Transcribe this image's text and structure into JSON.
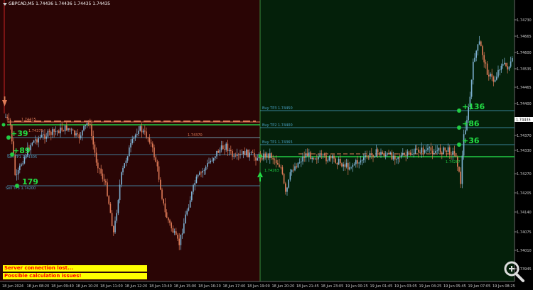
{
  "symbol_header": "GBPCAD,M5  1.74436  1.74436  1.74435  1.74435",
  "warnings": {
    "server": "Server connection lost...",
    "calc": "Possible calculation issues!"
  },
  "price_axis": [
    "1.74730",
    "1.74665",
    "1.74600",
    "1.74535",
    "1.74465",
    "1.74400",
    "1.74370",
    "1.74330",
    "1.74270",
    "1.74205",
    "1.74140",
    "1.74075",
    "1.74010",
    "1.73945"
  ],
  "current_price": "1.74435",
  "time_axis": [
    "18 Jun 2024",
    "18 Jun 08:20",
    "18 Jun 09:40",
    "18 Jun 10:20",
    "18 Jun 11:00",
    "18 Jun 12:20",
    "18 Jun 13:40",
    "18 Jun 15:00",
    "18 Jun 16:20",
    "18 Jun 17:40",
    "18 Jun 19:00",
    "18 Jun 20:20",
    "18 Jun 21:45",
    "18 Jun 23:05",
    "19 Jun 00:25",
    "19 Jun 01:45",
    "19 Jun 03:05",
    "19 Jun 04:25",
    "19 Jun 05:45",
    "19 Jun 07:05",
    "19 Jun 08:25"
  ],
  "levels": {
    "left_top": "1.74415",
    "left_mid": "1.74370",
    "left_upper_small": "1.74375",
    "tp3": "Buy TP3 1.74450",
    "tp2": "Buy TP2 1.74400",
    "tp1": "Buy TP1 1.74365",
    "sell_tp": "Sell TP3 1.74200",
    "left_entry_a": "Sell TP1 1.74305",
    "entry_right": "1.74263",
    "entry_right2": "1.74287"
  },
  "pips": {
    "p1": "+39",
    "p2": "+89",
    "p3": "179",
    "r1": "+136",
    "r2": "+86",
    "r3": "+36"
  },
  "colors": {
    "left_bg": "#2a0505",
    "right_bg": "#04200a",
    "bull": "#7fb3d5",
    "bear": "#e07b57",
    "green": "#22cc44",
    "level_blue": "#4aa3c8",
    "level_red": "#e07b57"
  }
}
